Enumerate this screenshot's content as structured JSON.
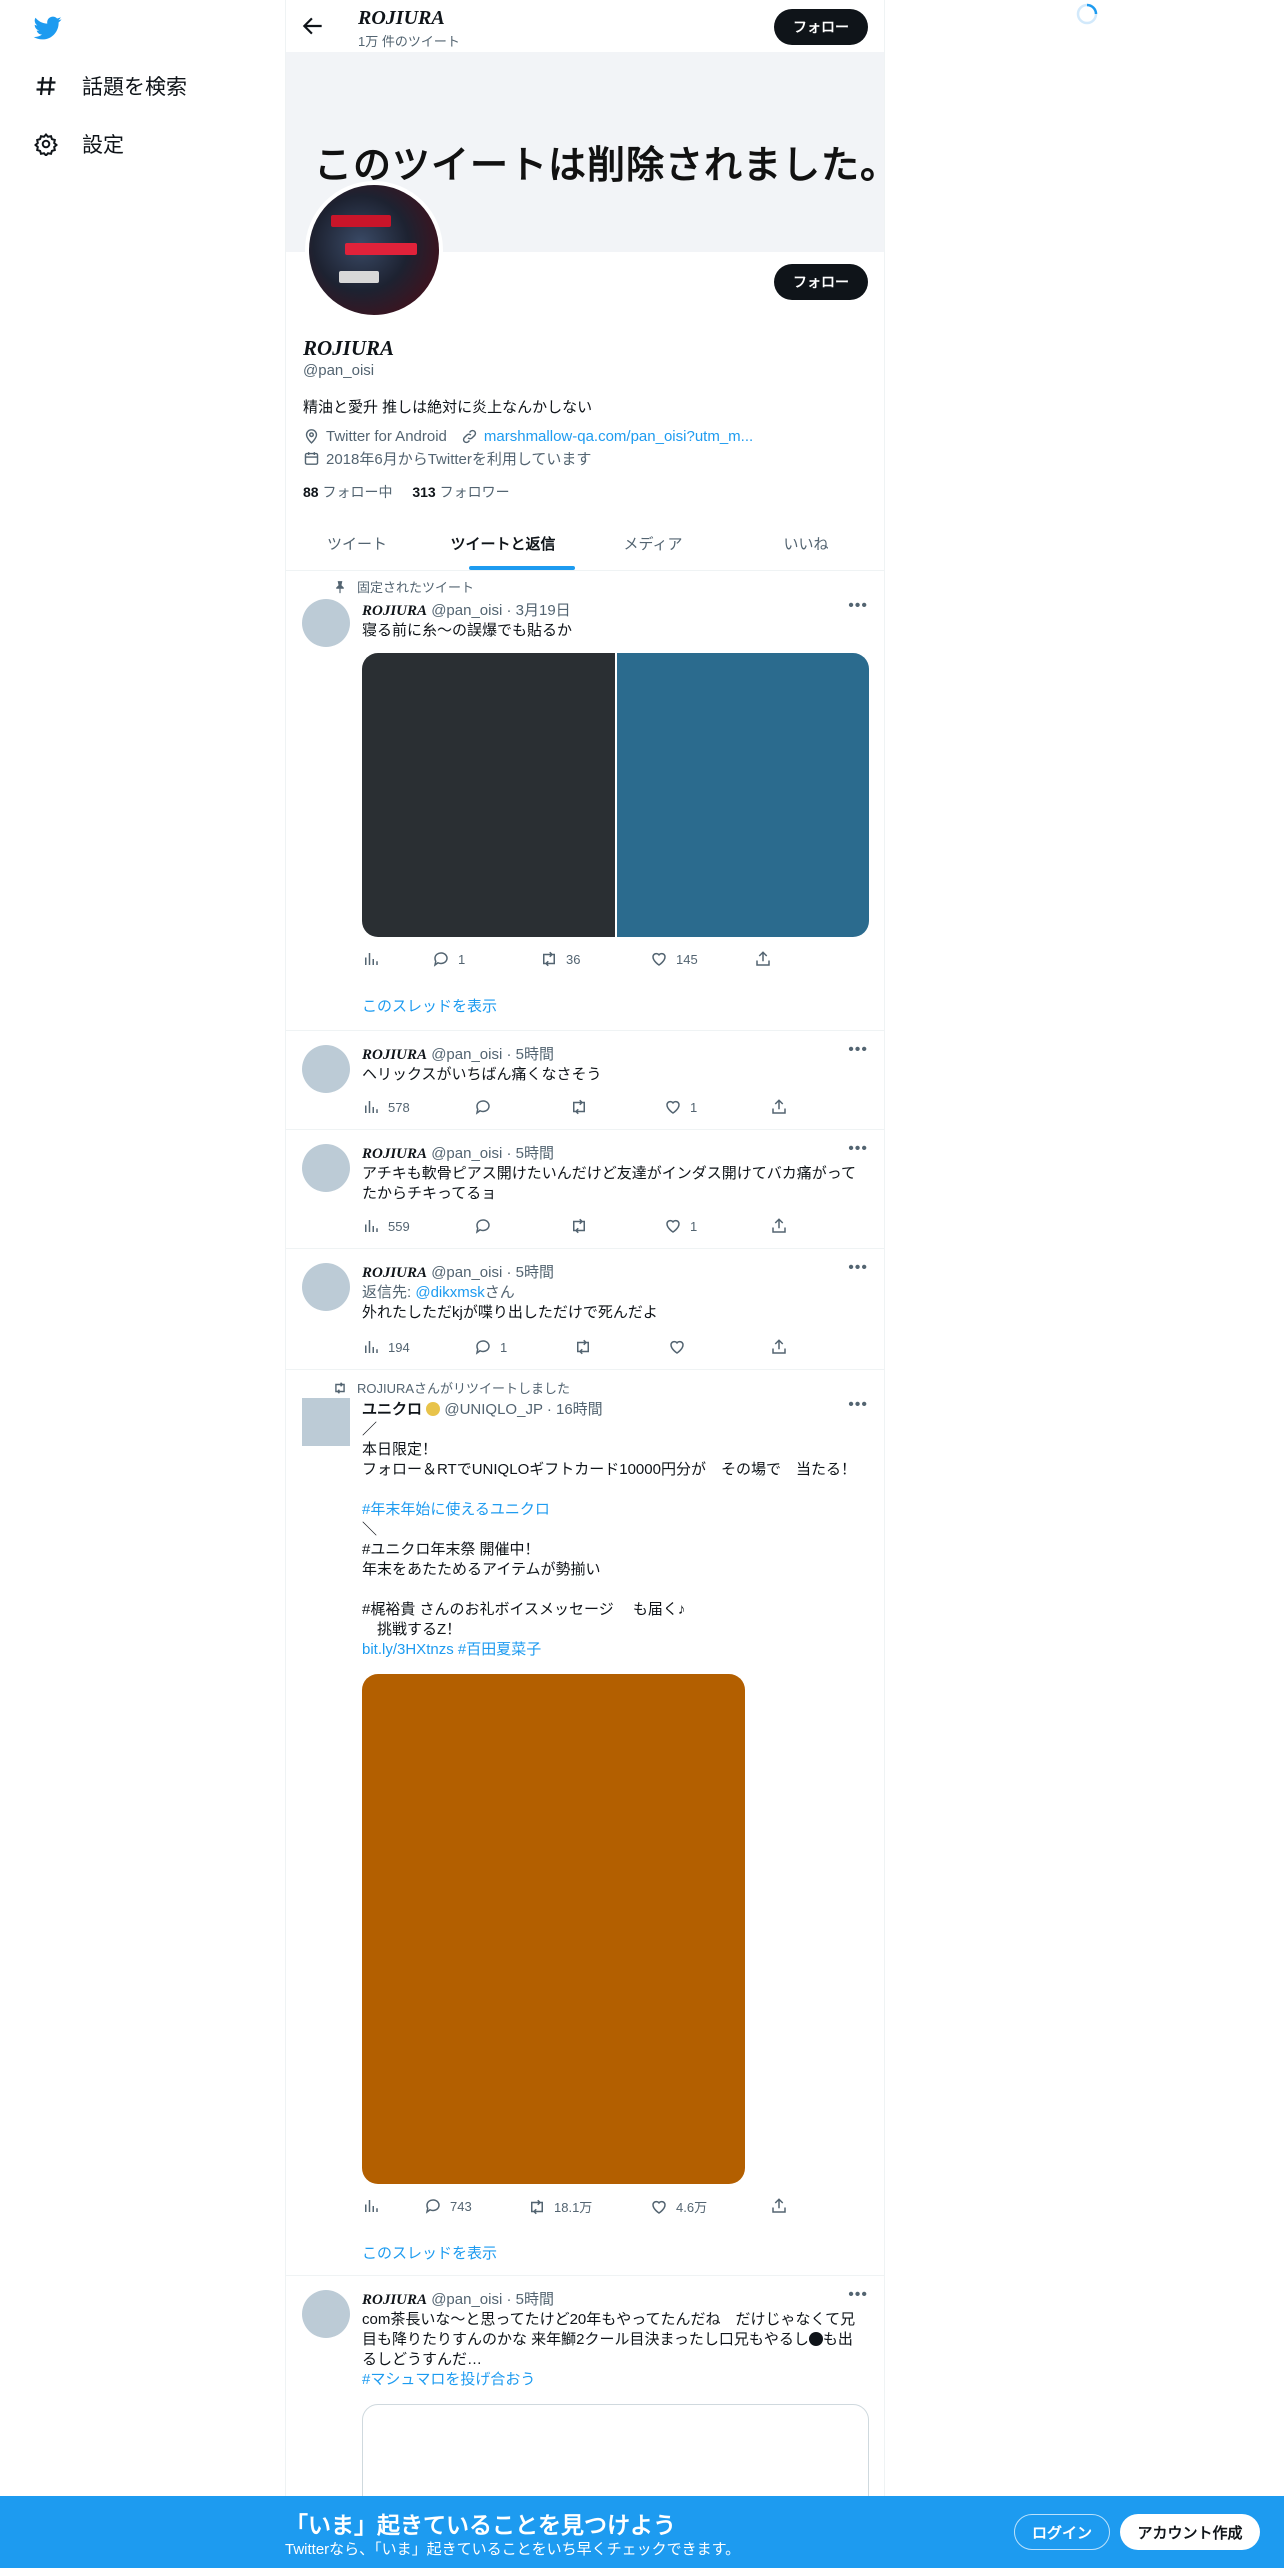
{
  "nav": {
    "explore_label": "話題を検索",
    "settings_label": "設定"
  },
  "header": {
    "name": "ROJIURA",
    "tweet_count": "1万 件のツイート",
    "follow_label": "フォロー"
  },
  "profile": {
    "banner_text": "このツイートは削除されました。",
    "follow_label": "フォロー",
    "name": "ROJIURA",
    "handle": "@pan_oisi",
    "bio": "精油と愛升 推しは絶対に炎上なんかしない",
    "location": "Twitter for Android",
    "website": "marshmallow-qa.com/pan_oisi?utm_m...",
    "joined": "2018年6月からTwitterを利用しています",
    "following_count": "88",
    "following_label": "フォロー中",
    "followers_count": "313",
    "followers_label": "フォロワー"
  },
  "tabs": [
    {
      "label": "ツイート"
    },
    {
      "label": "ツイートと返信"
    },
    {
      "label": "メディア"
    },
    {
      "label": "いいね"
    }
  ],
  "tweets": [
    {
      "pinned_label": "固定されたツイート",
      "name": "ROJIURA",
      "meta": "@pan_oisi · 3月19日",
      "text": [
        "寝る前に糸〜の誤爆でも貼るか"
      ],
      "media_colors": [
        "#2a2f33",
        "#2b6b8e"
      ],
      "stats": {
        "views": "",
        "replies": "1",
        "retweets": "36",
        "likes": "145"
      },
      "thread_label": "このスレッドを表示"
    },
    {
      "name": "ROJIURA",
      "meta": "@pan_oisi · 5時間",
      "text": [
        "ヘリックスがいちばん痛くなさそう"
      ],
      "stats": {
        "views": "578",
        "replies": "",
        "retweets": "",
        "likes": "1"
      }
    },
    {
      "name": "ROJIURA",
      "meta": "@pan_oisi · 5時間",
      "text": [
        "アチキも軟骨ピアス開けたいんだけど友達がインダス開けてバカ痛がって",
        "たからチキってるョ"
      ],
      "stats": {
        "views": "559",
        "replies": "",
        "retweets": "",
        "likes": "1"
      }
    },
    {
      "name": "ROJIURA",
      "meta": "@pan_oisi · 5時間",
      "reply_prefix": "返信先: ",
      "reply_to": "@dikxmsk",
      "reply_suffix": "さん",
      "text": [
        "外れたしただkjが喋り出しただけで死んだよ"
      ],
      "stats": {
        "views": "194",
        "replies": "1",
        "retweets": "",
        "likes": ""
      }
    },
    {
      "retweet_label": "ROJIURAさんがリツイートしました",
      "name": "ユニクロ",
      "meta": "@UNIQLO_JP · 16時間",
      "text": [
        "／",
        "本日限定！",
        "フォロー＆RTでUNIQLOギフトカード10000円分が　その場で　当たる！",
        "",
        "#年末年始に使えるユニクロ",
        "＼",
        "#ユニクロ年末祭 開催中！",
        "年末をあたためるアイテムが勢揃い",
        "",
        "#梶裕貴 さんのお礼ボイスメッセージ　 も届く♪",
        "　挑戦するZ！",
        "bit.ly/3HXtnzs #百田夏菜子"
      ],
      "media_color": "#b35f00",
      "stats": {
        "views": "",
        "replies": "743",
        "retweets": "18.1万",
        "likes": "4.6万"
      },
      "thread_label": "このスレッドを表示"
    },
    {
      "name": "ROJIURA",
      "meta": "@pan_oisi · 5時間",
      "text": [
        "com茶長いな〜と思ってたけど20年もやってたんだね　だけじゃなくて兄",
        "目も降りたりすんのかな 来年鰤2クール目決まったし口兄もやるし",
        "るしどうすんだ…",
        "#マシュマロを投げ合おう"
      ],
      "quote_suffix": "も出"
    }
  ],
  "bottom_bar": {
    "title": "「いま」起きていることを見つけよう",
    "subtitle": "Twitterなら、「いま」起きていることをいち早くチェックできます。",
    "login_label": "ログイン",
    "signup_label": "アカウント作成"
  },
  "colors": {
    "accent": "#1d9bf0",
    "text": "#0f1419",
    "muted": "#536471"
  }
}
